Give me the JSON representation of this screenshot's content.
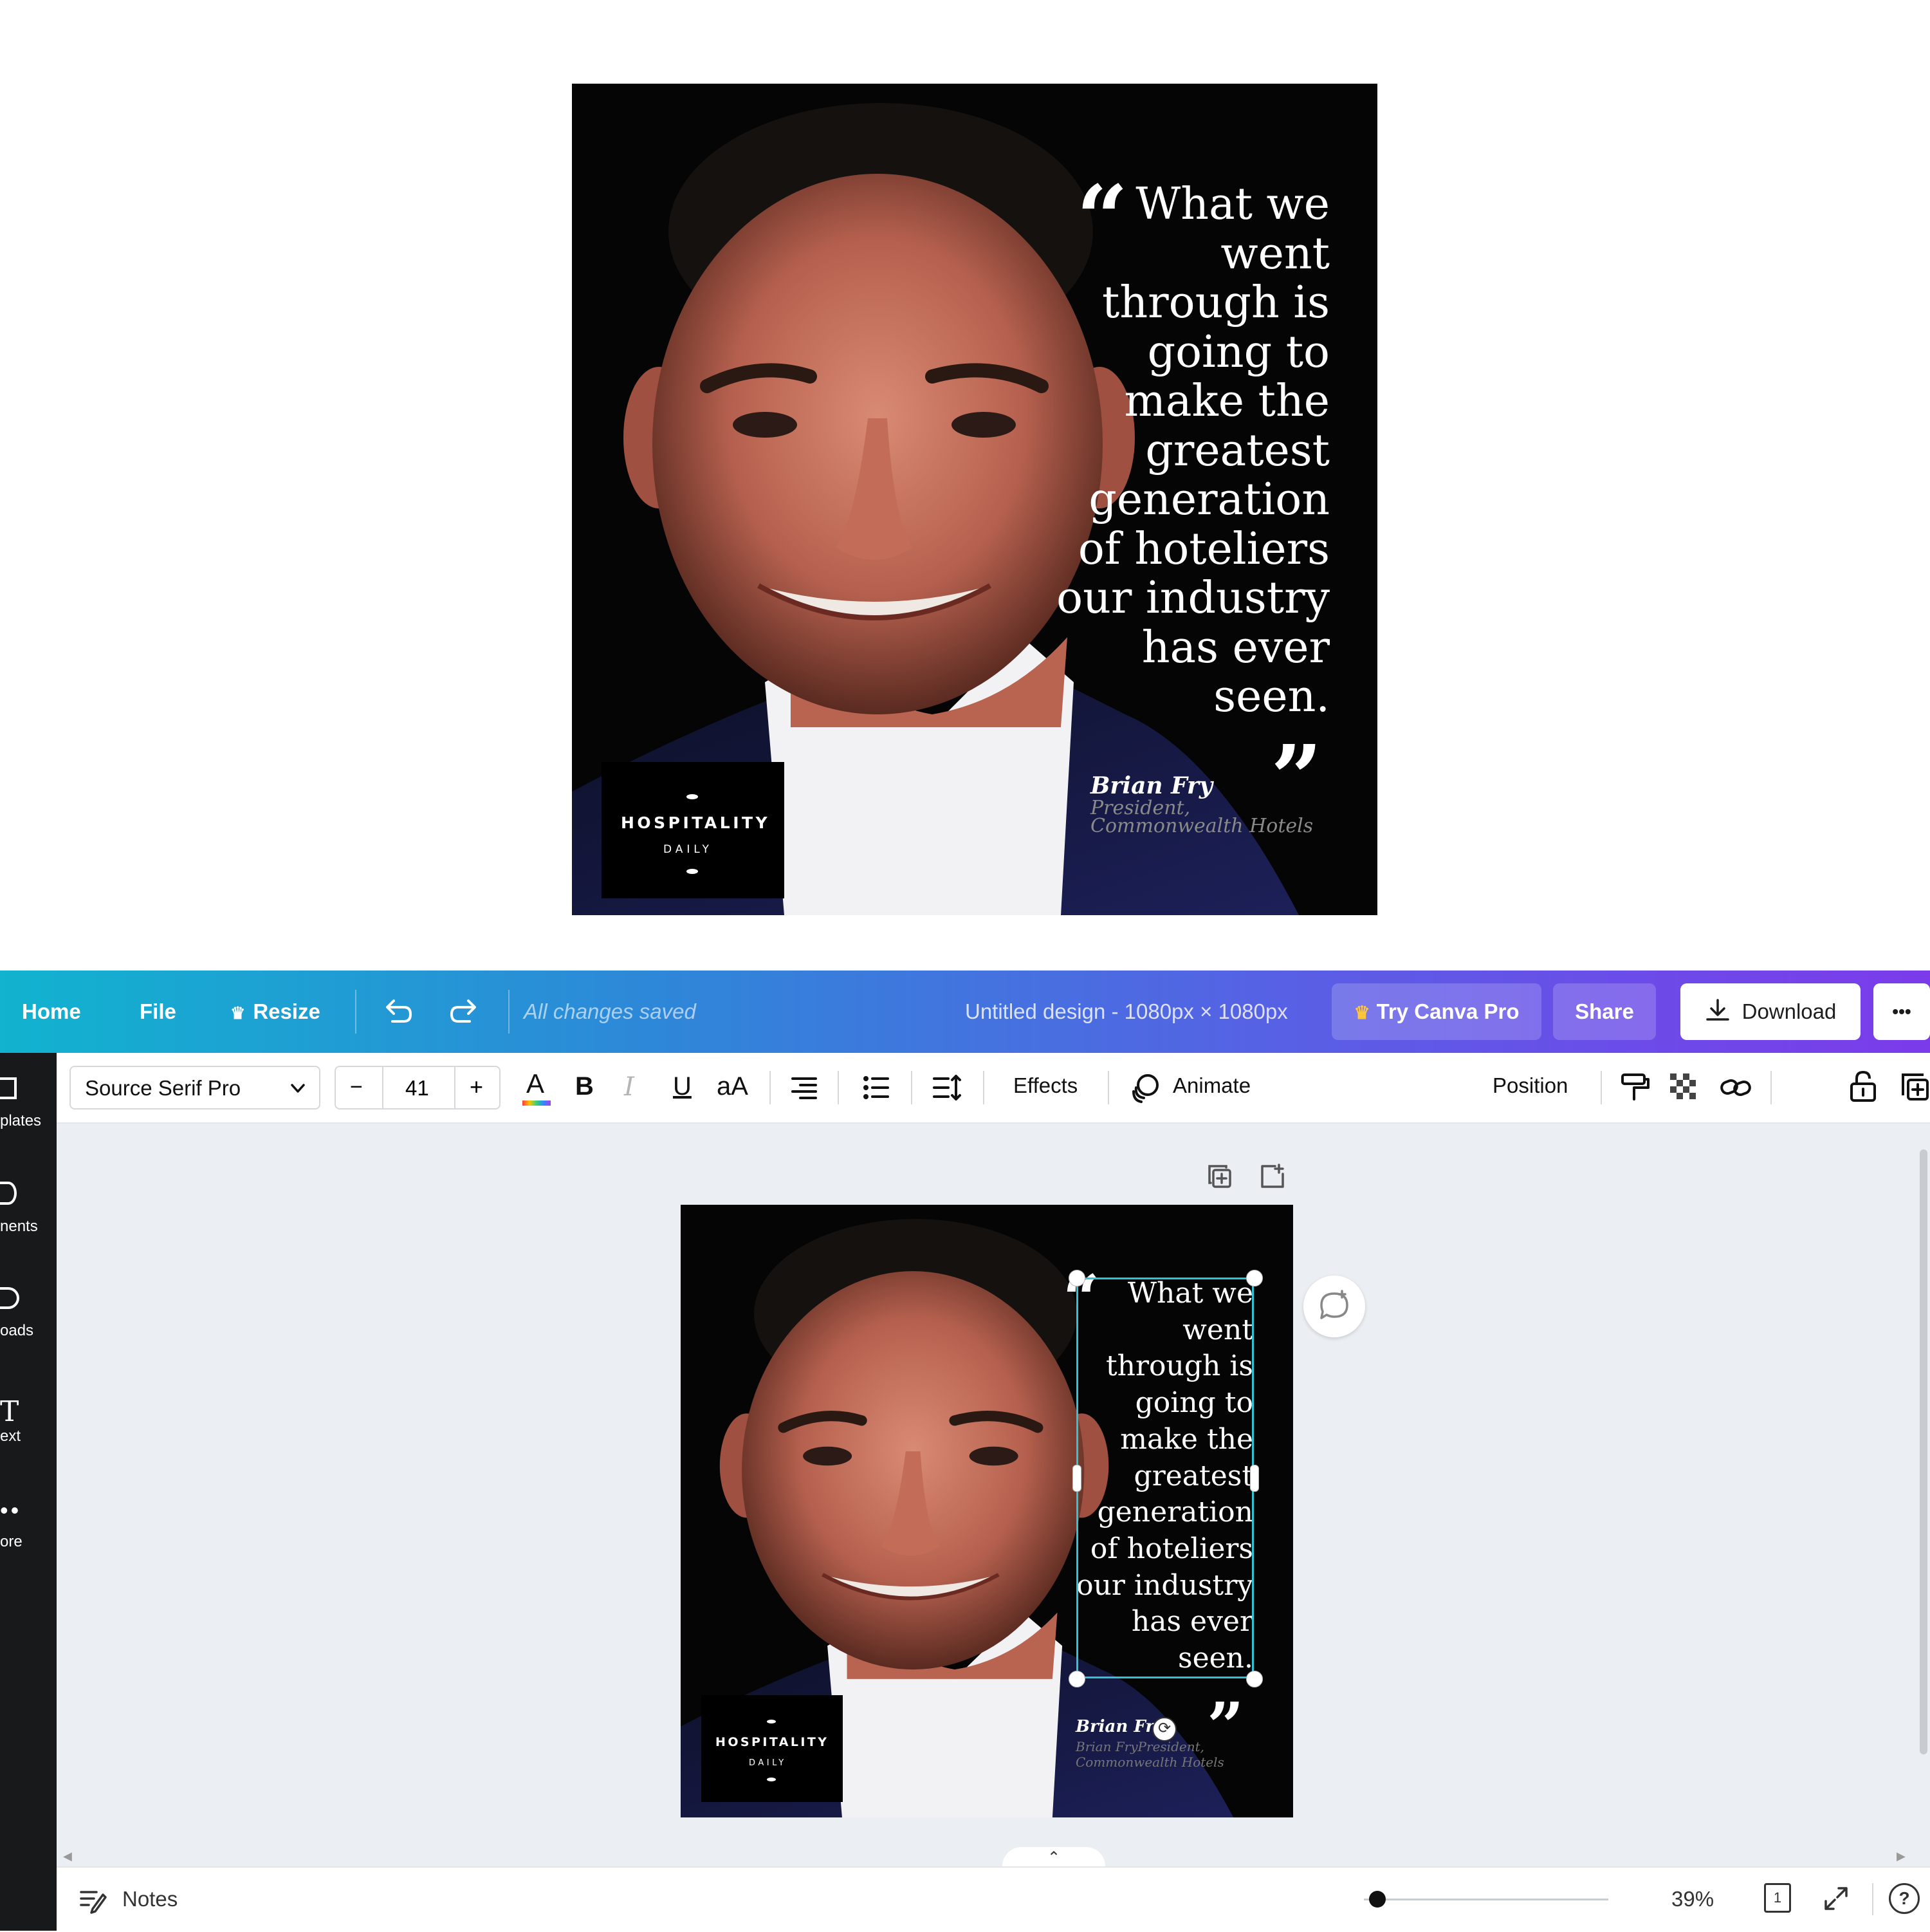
{
  "poster": {
    "quote_lines": [
      "What we",
      "went",
      "through is",
      "going to",
      "make the",
      "greatest",
      "generation",
      "of hoteliers",
      "our industry",
      "has ever",
      "seen."
    ],
    "open_quote": "“",
    "close_quote": "”",
    "author": "Brian Fry",
    "role_line1": "President,",
    "role_line2": "Commonwealth Hotels",
    "logo_title": "HOSPITALITY",
    "logo_sub": "DAILY"
  },
  "canvas_poster": {
    "author_role": "Brian FryPresident,",
    "role_line2": "Commonwealth Hotels"
  },
  "topbar": {
    "home": "Home",
    "file": "File",
    "resize": "Resize",
    "save_status": "All changes saved",
    "title": "Untitled design - 1080px × 1080px",
    "try_pro": "Try Canva Pro",
    "share": "Share",
    "download": "Download",
    "more": "•••"
  },
  "sidebar": {
    "items": [
      "plates",
      "nents",
      "oads",
      "ext",
      "ore"
    ]
  },
  "toolbar": {
    "font": "Source Serif Pro",
    "font_size": "41",
    "minus": "−",
    "plus": "+",
    "case": "aA",
    "effects": "Effects",
    "animate": "Animate",
    "position": "Position"
  },
  "bottombar": {
    "notes": "Notes",
    "zoom": "39%",
    "page": "1"
  },
  "colors": {
    "accent_selection": "#2ec4d4",
    "topbar_start": "#11b3cf",
    "topbar_end": "#7b3bea"
  }
}
